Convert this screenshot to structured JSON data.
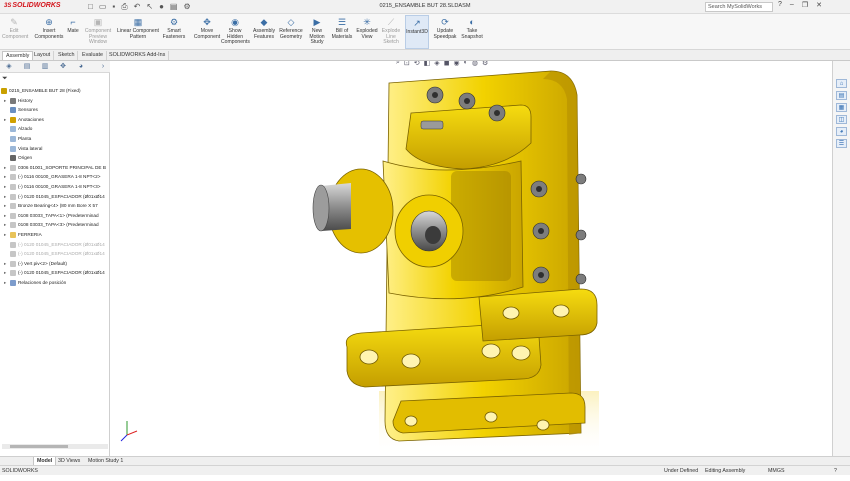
{
  "app": {
    "logo_prefix": "3S",
    "logo": "SOLIDWORKS"
  },
  "title": "0215_ENSAMBLE BUT 28.SLDASM",
  "search": {
    "placeholder": "Search MySolidWorks"
  },
  "ribbon": [
    {
      "label": "Edit\nComponent",
      "icon": "edit-component-icon",
      "glyph": "✎",
      "state": "dim"
    },
    {
      "label": "Insert\nComponents",
      "icon": "insert-components-icon",
      "glyph": "⊕",
      "state": "normal"
    },
    {
      "label": "Mate",
      "icon": "mate-icon",
      "glyph": "⌐",
      "state": "normal"
    },
    {
      "label": "Component\nPreview\nWindow",
      "icon": "component-preview-icon",
      "glyph": "▣",
      "state": "dim"
    },
    {
      "label": "Linear Component\nPattern",
      "icon": "linear-pattern-icon",
      "glyph": "▦",
      "state": "normal"
    },
    {
      "label": "Smart\nFasteners",
      "icon": "smart-fasteners-icon",
      "glyph": "⚙",
      "state": "normal"
    },
    {
      "label": "Move\nComponent",
      "icon": "move-component-icon",
      "glyph": "✥",
      "state": "normal"
    },
    {
      "label": "Show\nHidden\nComponents",
      "icon": "show-hidden-icon",
      "glyph": "◉",
      "state": "normal"
    },
    {
      "label": "Assembly\nFeatures",
      "icon": "assembly-features-icon",
      "glyph": "◆",
      "state": "normal"
    },
    {
      "label": "Reference\nGeometry",
      "icon": "reference-geometry-icon",
      "glyph": "◇",
      "state": "normal"
    },
    {
      "label": "New\nMotion\nStudy",
      "icon": "motion-study-icon",
      "glyph": "▶",
      "state": "normal"
    },
    {
      "label": "Bill of\nMaterials",
      "icon": "bom-icon",
      "glyph": "☰",
      "state": "normal"
    },
    {
      "label": "Exploded\nView",
      "icon": "exploded-view-icon",
      "glyph": "✳",
      "state": "normal"
    },
    {
      "label": "Explode\nLine\nSketch",
      "icon": "explode-line-icon",
      "glyph": "⟋",
      "state": "dim"
    },
    {
      "label": "Instant3D",
      "icon": "instant3d-icon",
      "glyph": "↗",
      "state": "active"
    },
    {
      "label": "Update\nSpeedpak",
      "icon": "speedpak-icon",
      "glyph": "⟳",
      "state": "normal"
    },
    {
      "label": "Take\nSnapshot",
      "icon": "snapshot-icon",
      "glyph": "◐",
      "state": "normal"
    }
  ],
  "tabs": [
    "Assembly",
    "Layout",
    "Sketch",
    "Evaluate",
    "SOLIDWORKS Add-Ins"
  ],
  "tree": [
    {
      "label": "0215_ENSAMBLE BUT 28  (Fixed)",
      "icon": "assembly-icon",
      "arrow": "",
      "indent": 0,
      "state": "normal"
    },
    {
      "label": "History",
      "icon": "history-icon",
      "arrow": "▸",
      "indent": 1,
      "state": "normal"
    },
    {
      "label": "Sensores",
      "icon": "sensors-icon",
      "arrow": "",
      "indent": 1,
      "state": "normal"
    },
    {
      "label": "Anotaciones",
      "icon": "annotations-icon",
      "arrow": "▸",
      "indent": 1,
      "state": "normal"
    },
    {
      "label": "Alzado",
      "icon": "plane-icon",
      "arrow": "",
      "indent": 1,
      "state": "normal"
    },
    {
      "label": "Planta",
      "icon": "plane-icon",
      "arrow": "",
      "indent": 1,
      "state": "normal"
    },
    {
      "label": "Vista lateral",
      "icon": "plane-icon",
      "arrow": "",
      "indent": 1,
      "state": "normal"
    },
    {
      "label": "Origen",
      "icon": "origin-icon",
      "arrow": "",
      "indent": 1,
      "state": "normal"
    },
    {
      "label": "0306 01001_SOPORTE PRINCIPAL DE B",
      "icon": "part-icon",
      "arrow": "▸",
      "indent": 1,
      "state": "normal"
    },
    {
      "label": "(-) 0116 00100_GRASERA 1-8 NPT<2>",
      "icon": "part-icon",
      "arrow": "▸",
      "indent": 1,
      "state": "normal"
    },
    {
      "label": "(-) 0116 00100_GRASERA 1-8 NPT<3>",
      "icon": "part-icon",
      "arrow": "▸",
      "indent": 1,
      "state": "normal"
    },
    {
      "label": "(-) 0120 01045_ESPACIADOR (Ø01xØ14",
      "icon": "part-icon",
      "arrow": "▸",
      "indent": 1,
      "state": "normal"
    },
    {
      "label": "Bronze Bearing<4> (80 mm Bore X 57",
      "icon": "part-icon",
      "arrow": "▸",
      "indent": 1,
      "state": "normal"
    },
    {
      "label": "0108 03033_TAPA<1> (Predeterminad",
      "icon": "part-icon",
      "arrow": "▸",
      "indent": 1,
      "state": "normal"
    },
    {
      "label": "0108 03033_TAPA<3> (Predeterminad",
      "icon": "part-icon",
      "arrow": "▸",
      "indent": 1,
      "state": "normal"
    },
    {
      "label": "FERRERIA",
      "icon": "folder-icon",
      "arrow": "▸",
      "indent": 1,
      "state": "normal"
    },
    {
      "label": "(-) 0120 01045_ESPACIADOR (Ø01xØ14",
      "icon": "part-icon",
      "arrow": "",
      "indent": 1,
      "state": "dim"
    },
    {
      "label": "(-) 0120 01045_ESPACIADOR (Ø01xØ14",
      "icon": "part-icon",
      "arrow": "",
      "indent": 1,
      "state": "dim"
    },
    {
      "label": "(-) Vert piv<2> (Default)",
      "icon": "part-icon",
      "arrow": "▸",
      "indent": 1,
      "state": "normal"
    },
    {
      "label": "(-) 0120 01045_ESPACIADOR (Ø01xØ14",
      "icon": "part-icon",
      "arrow": "▸",
      "indent": 1,
      "state": "normal"
    },
    {
      "label": "Relaciones de posición",
      "icon": "mates-icon",
      "arrow": "▸",
      "indent": 1,
      "state": "normal"
    }
  ],
  "bottom_tabs": [
    "Model",
    "3D Views",
    "Motion Study 1"
  ],
  "status": {
    "app": "SOLIDWORKS",
    "definition": "Under Defined",
    "mode": "Editing Assembly",
    "units": "MMGS"
  },
  "colors": {
    "part_yellow": "#f2d200",
    "part_shade": "#b89400",
    "steel": "#8a8a8a",
    "selection_blue": "#3b6ea5"
  }
}
